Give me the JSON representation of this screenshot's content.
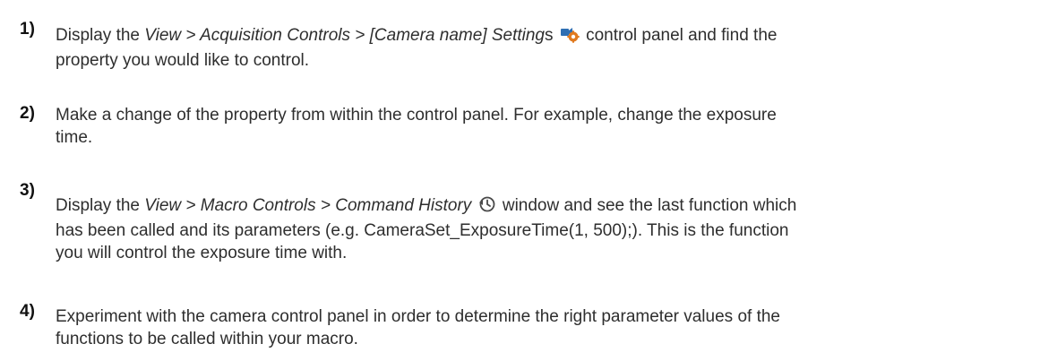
{
  "steps": [
    {
      "number": "1)",
      "pre": "Display the ",
      "path": "View > Acquisition Controls > [Camera name] Setting",
      "path_suffix": "s",
      "icon": "camera-settings-icon",
      "post_line1": " control panel and find the",
      "line2": "property you would like to control."
    },
    {
      "number": "2)",
      "line1": "Make a change of the property from within the control panel. For example, change the exposure",
      "line2": "time."
    },
    {
      "number": "3)",
      "pre": "Display the ",
      "path": "View > Macro Controls > Command History",
      "icon": "command-history-icon",
      "post_line1": " window and see the last function which",
      "line2": "has been called and its parameters (e.g. CameraSet_ExposureTime(1, 500);). This is the function",
      "line3": "you will control the exposure time with."
    },
    {
      "number": "4)",
      "line1": "Experiment with the camera control panel in order to determine the right parameter values of the",
      "line2": "functions to be called within your macro."
    }
  ],
  "colors": {
    "icon_blue": "#2f6fb3",
    "icon_orange": "#e07a1f",
    "text": "#2e2e2e"
  }
}
